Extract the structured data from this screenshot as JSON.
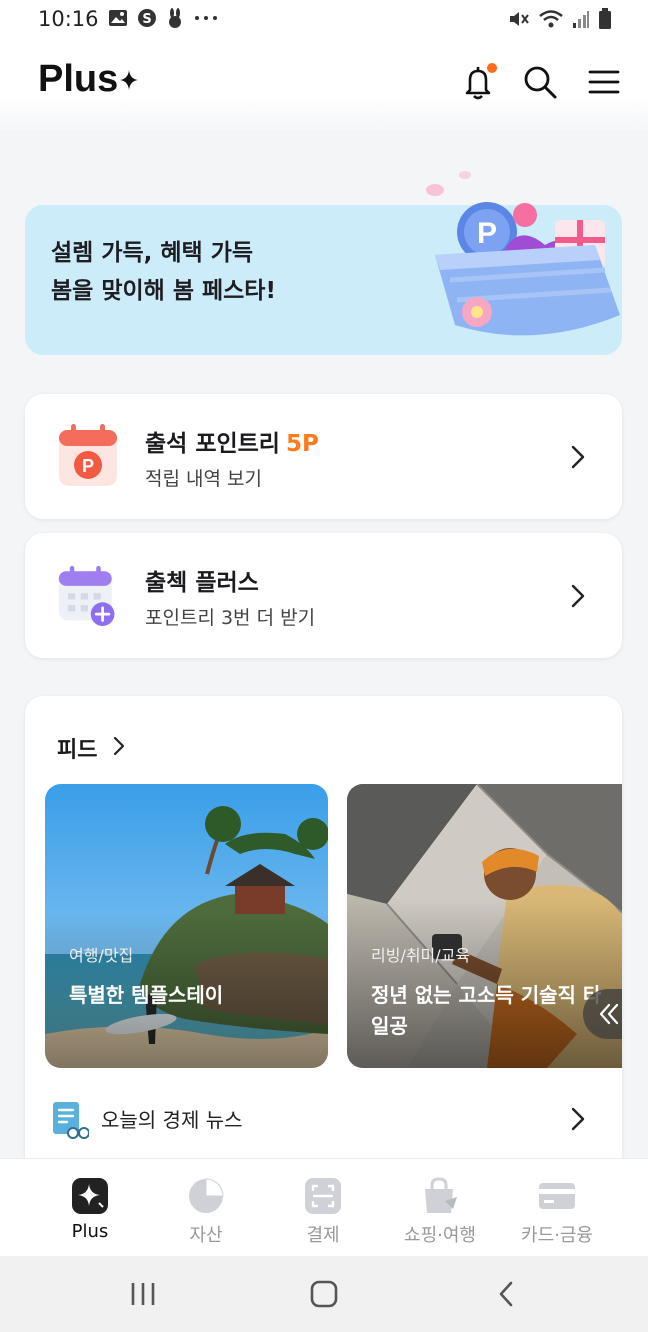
{
  "status_bar": {
    "time": "10:16",
    "icons_left": [
      "gallery-icon",
      "s-app-icon",
      "rabbit-icon",
      "more-dots-icon"
    ],
    "icons_right": [
      "mute-icon",
      "wifi-icon",
      "signal-icon",
      "battery-icon"
    ]
  },
  "header": {
    "logo": "Plus",
    "icons": [
      "bell-icon",
      "search-icon",
      "menu-icon"
    ],
    "notification_dot_color": "#ff6b1a"
  },
  "banner": {
    "line1": "설렘 가득, 혜택 가득",
    "line2": "봄을 맞이해 봄 페스타!",
    "background": "#cdecf9"
  },
  "cards": [
    {
      "title": "출석 포인트리",
      "accent": "5P",
      "subtitle": "적립 내역 보기",
      "icon": "point-calendar-icon"
    },
    {
      "title": "출첵 플러스",
      "accent": "",
      "subtitle": "포인트리 3번 더 받기",
      "icon": "calendar-plus-icon"
    }
  ],
  "feed": {
    "title": "피드",
    "tiles": [
      {
        "category": "여행/맛집",
        "title": "특별한 템플스테이"
      },
      {
        "category": "리빙/취미/교육",
        "title": "정년 없는 고소득 기술직 타일공"
      }
    ],
    "news": "오늘의 경제 뉴스"
  },
  "tabs": [
    {
      "label": "Plus",
      "active": true
    },
    {
      "label": "자산",
      "active": false
    },
    {
      "label": "결제",
      "active": false
    },
    {
      "label": "쇼핑·여행",
      "active": false
    },
    {
      "label": "카드·금융",
      "active": false
    }
  ]
}
